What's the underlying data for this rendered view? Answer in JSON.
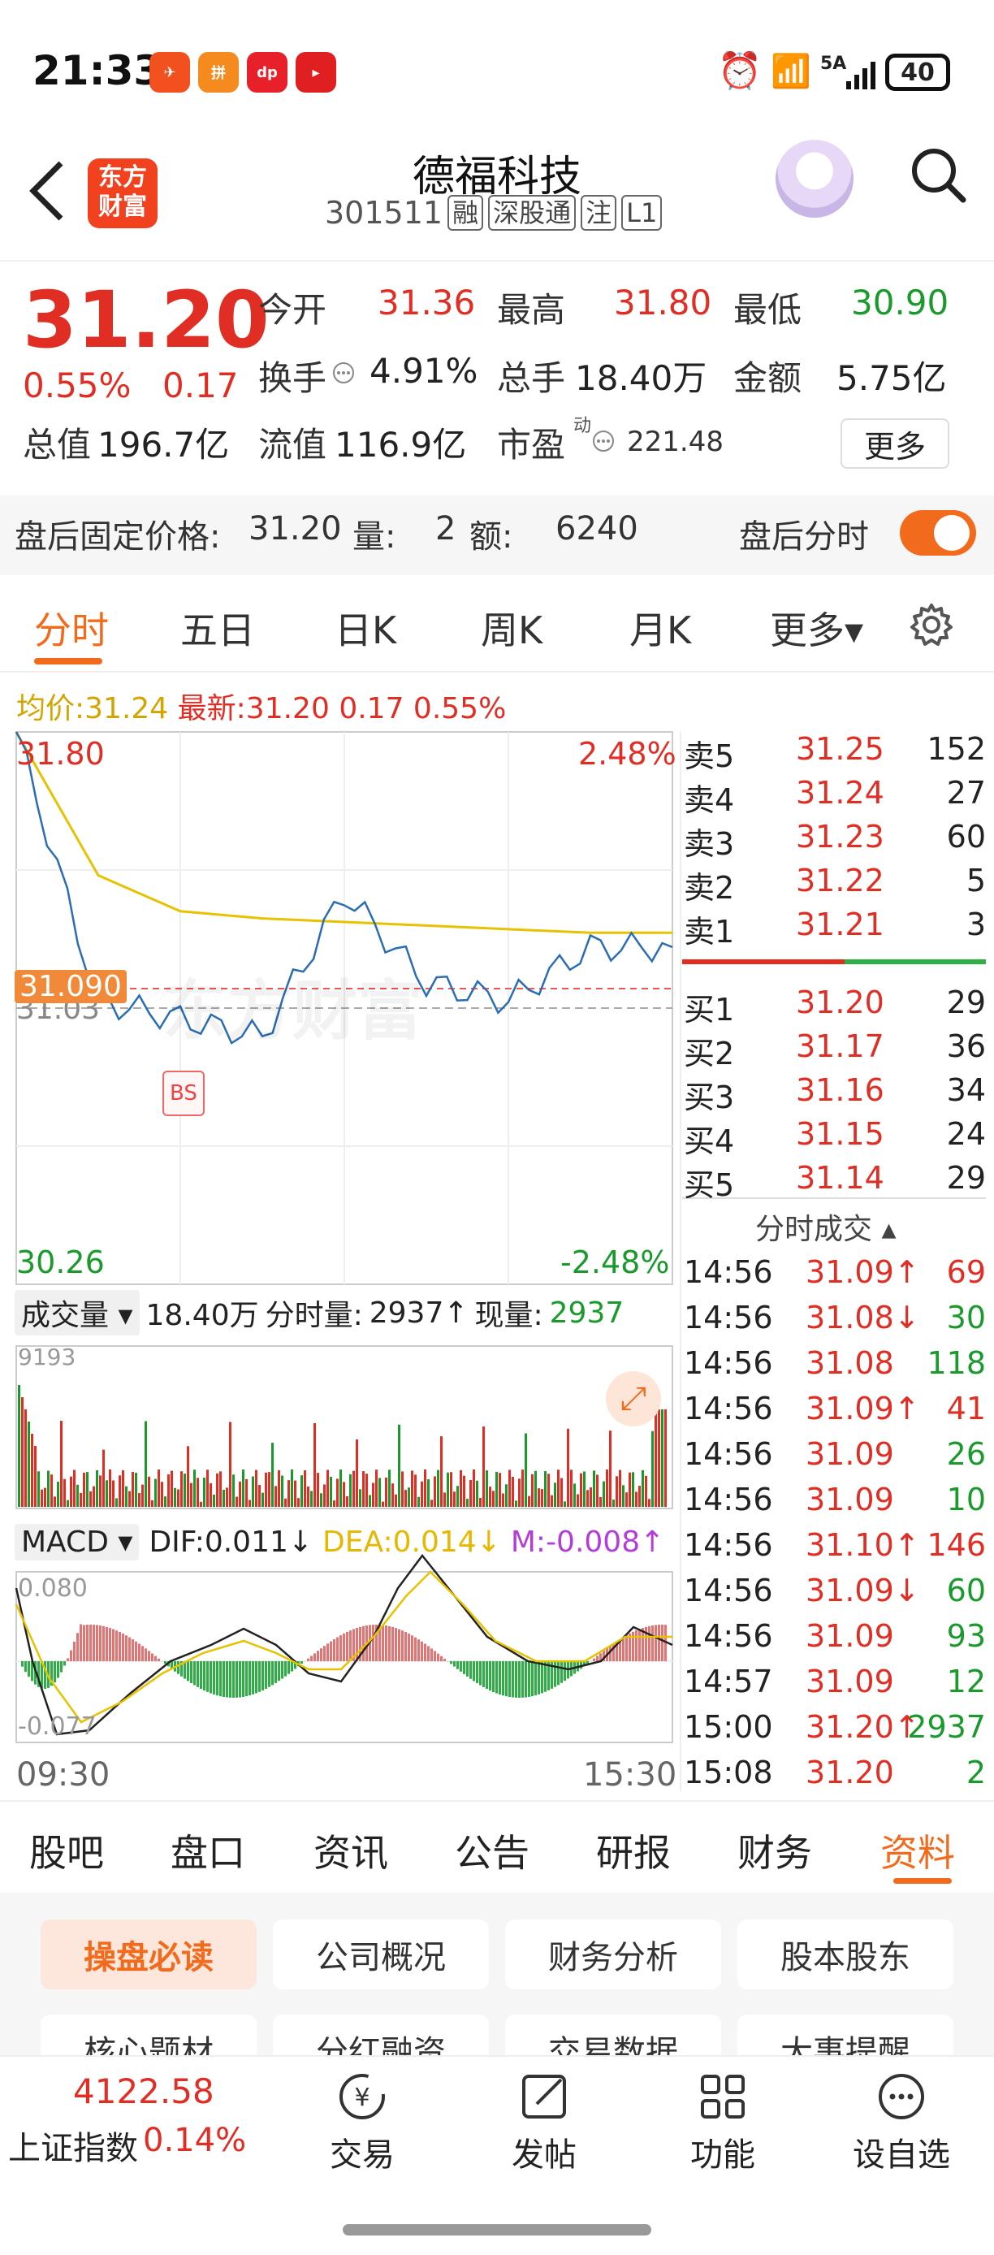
{
  "status": {
    "time": "21:33",
    "battery": "40",
    "signal": "5A"
  },
  "header": {
    "name": "德福科技",
    "code": "301511",
    "tags": [
      "融",
      "深股通",
      "注",
      "L1"
    ],
    "logo_line1": "东方",
    "logo_line2": "财富"
  },
  "quote": {
    "price": "31.20",
    "pct": "0.55%",
    "chg": "0.17",
    "open_l": "今开",
    "open": "31.36",
    "high_l": "最高",
    "high": "31.80",
    "low_l": "最低",
    "low": "30.90",
    "turn_l": "换手",
    "turn": "4.91%",
    "vol_l": "总手",
    "vol": "18.40万",
    "amt_l": "金额",
    "amt": "5.75亿",
    "mcap_l": "总值",
    "mcap": "196.7亿",
    "float_l": "流值",
    "float": "116.9亿",
    "pe_l": "市盈",
    "pe_sup": "动",
    "pe": "221.48",
    "more": "更多"
  },
  "afterhours": {
    "label": "盘后固定价格:",
    "price": "31.20",
    "qty_l": "量:",
    "qty": "2",
    "amt_l": "额:",
    "amt": "6240",
    "toggle_label": "盘后分时"
  },
  "chart_tabs": [
    "分时",
    "五日",
    "日K",
    "周K",
    "月K",
    "更多▾"
  ],
  "intraday": {
    "avg_l": "均价:",
    "avg": "31.24",
    "last_l": "最新:",
    "last": "31.20",
    "chg": "0.17",
    "pct": "0.55%",
    "ymax": "31.80",
    "ymin": "30.26",
    "pmax": "2.48%",
    "pmin": "-2.48%",
    "cur_tag": "31.090",
    "ref": "31.03",
    "watermark": "东方财富",
    "vol_l": "成交量",
    "vol_total": "18.40万",
    "fen_l": "分时量:",
    "fen": "2937↑",
    "cur_l": "现量:",
    "cur": "2937",
    "vol_max": "9193",
    "macd_l": "MACD",
    "dif": "DIF:0.011↓",
    "dea": "DEA:0.014↓",
    "m": "M:-0.008↑",
    "macd_max": "0.080",
    "macd_min": "-0.077",
    "t_start": "09:30",
    "t_end": "15:30"
  },
  "chart_data": {
    "type": "line",
    "x": [
      "09:30",
      "15:30"
    ],
    "ylim": [
      30.26,
      31.8
    ],
    "series": [
      {
        "name": "均价",
        "values": [
          31.8,
          31.4,
          31.3,
          31.28,
          31.27,
          31.26,
          31.25,
          31.24,
          31.24
        ]
      },
      {
        "name": "最新",
        "values": [
          31.8,
          31.05,
          31.0,
          30.95,
          31.35,
          31.1,
          31.05,
          31.2,
          31.2
        ]
      }
    ]
  },
  "orderbook": {
    "asks": [
      [
        "卖5",
        "31.25",
        "152"
      ],
      [
        "卖4",
        "31.24",
        "27"
      ],
      [
        "卖3",
        "31.23",
        "60"
      ],
      [
        "卖2",
        "31.22",
        "5"
      ],
      [
        "卖1",
        "31.21",
        "3"
      ]
    ],
    "bids": [
      [
        "买1",
        "31.20",
        "29"
      ],
      [
        "买2",
        "31.17",
        "36"
      ],
      [
        "买3",
        "31.16",
        "34"
      ],
      [
        "买4",
        "31.15",
        "24"
      ],
      [
        "买5",
        "31.14",
        "29"
      ]
    ]
  },
  "ticks": {
    "title": "分时成交 ▴",
    "rows": [
      [
        "14:56",
        "31.09↑",
        "69",
        "r",
        "r"
      ],
      [
        "14:56",
        "31.08↓",
        "30",
        "r",
        "g"
      ],
      [
        "14:56",
        "31.08",
        "118",
        "r",
        "g"
      ],
      [
        "14:56",
        "31.09↑",
        "41",
        "r",
        "r"
      ],
      [
        "14:56",
        "31.09",
        "26",
        "r",
        "g"
      ],
      [
        "14:56",
        "31.09",
        "10",
        "r",
        "g"
      ],
      [
        "14:56",
        "31.10↑",
        "146",
        "r",
        "r"
      ],
      [
        "14:56",
        "31.09↓",
        "60",
        "r",
        "g"
      ],
      [
        "14:56",
        "31.09",
        "93",
        "r",
        "g"
      ],
      [
        "14:57",
        "31.09",
        "12",
        "r",
        "g"
      ],
      [
        "15:00",
        "31.20↑",
        "2937",
        "r",
        "g"
      ],
      [
        "15:08",
        "31.20",
        "2",
        "r",
        "g"
      ]
    ]
  },
  "bottom_tabs": [
    "股吧",
    "盘口",
    "资讯",
    "公告",
    "研报",
    "财务",
    "资料"
  ],
  "pills": [
    "操盘必读",
    "公司概况",
    "财务分析",
    "股本股东"
  ],
  "pills2": [
    "核心题材",
    "分红融资",
    "交易数据",
    "大事提醒"
  ],
  "index": {
    "value": "4122.58",
    "name": "上证指数",
    "pct": "0.14%"
  },
  "nav": [
    "交易",
    "发帖",
    "功能",
    "设自选"
  ]
}
